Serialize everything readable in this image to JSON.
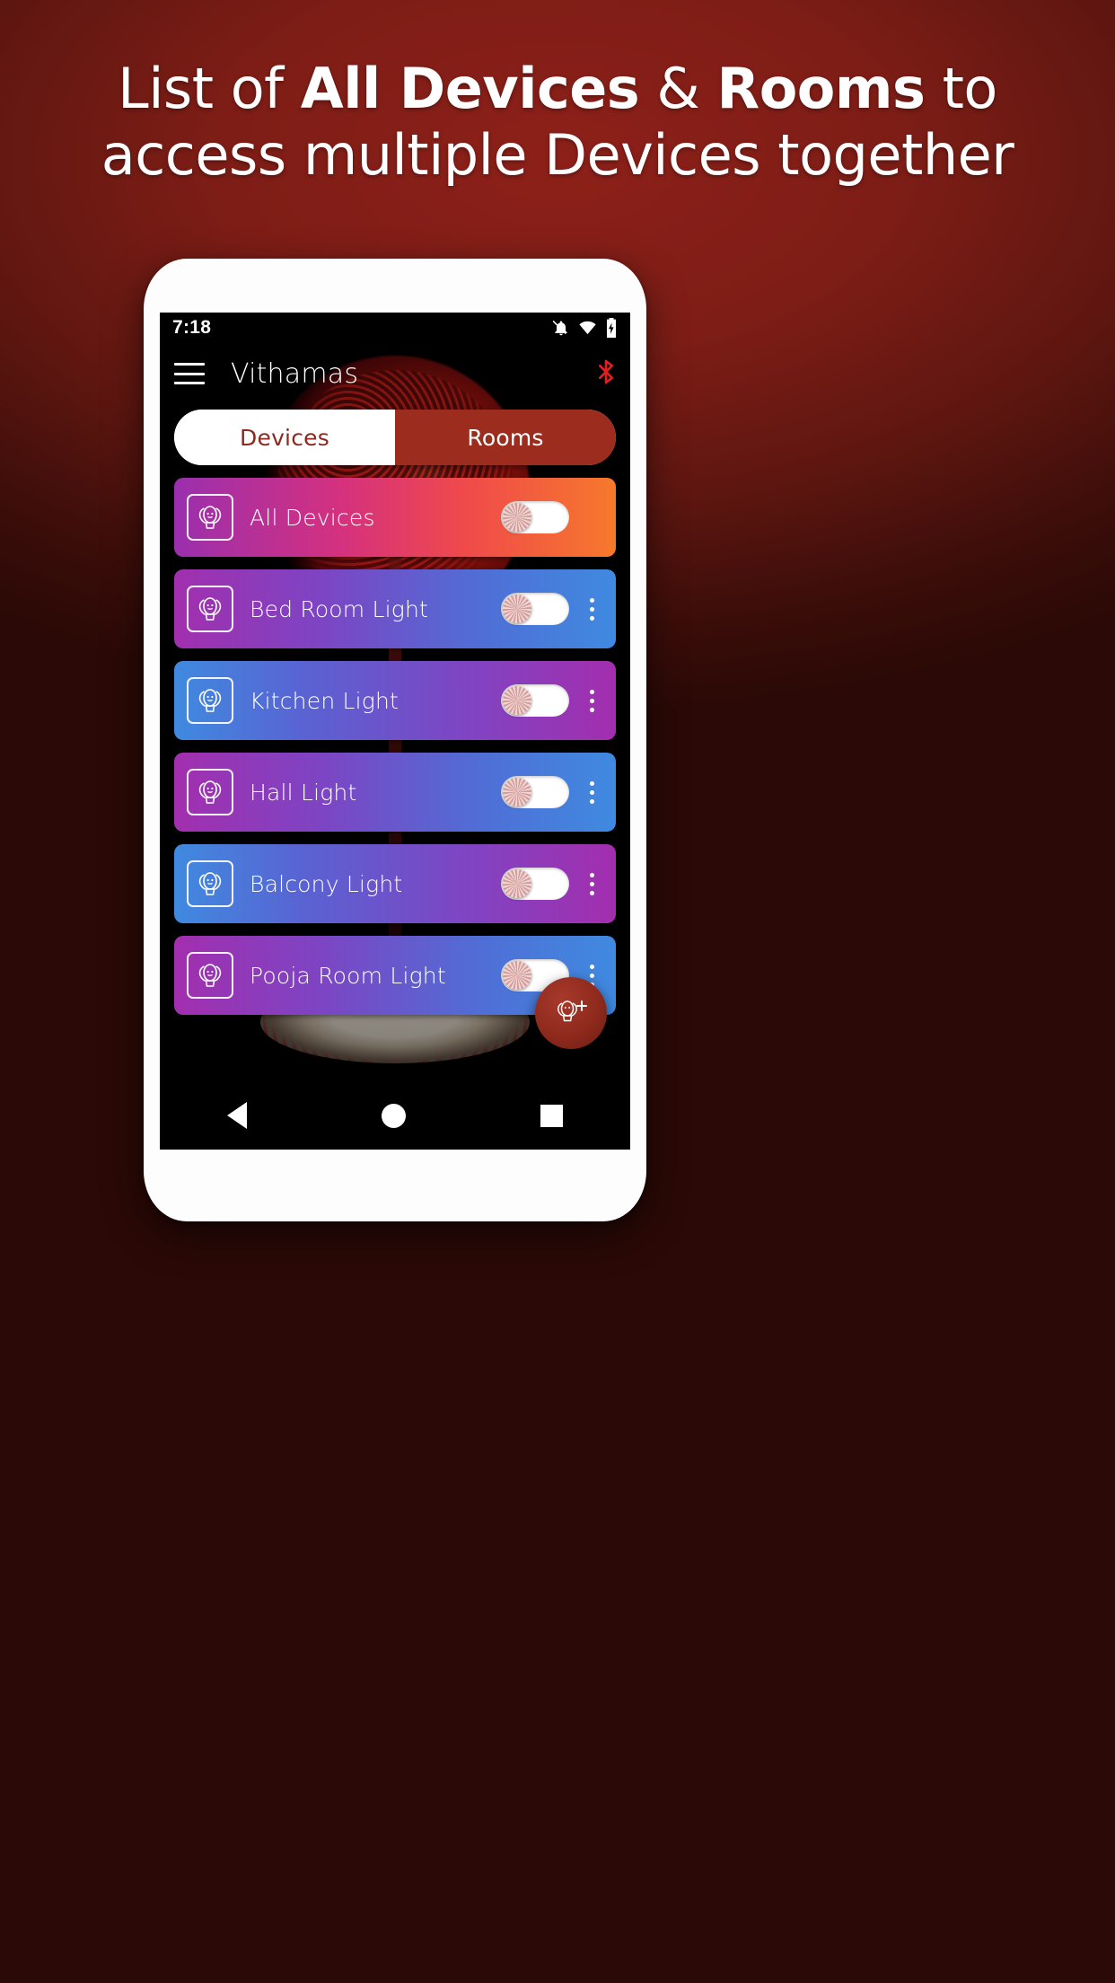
{
  "promo": {
    "line1_pre": "List of ",
    "line1_bold": "All Devices",
    "line1_mid": " & ",
    "line1_bold2": "Rooms",
    "line1_post": " to",
    "line2": "access multiple Devices together"
  },
  "colors": {
    "background_red": "#7d1d16",
    "tab_active_bg": "#9c2c1d",
    "tab_inactive_text": "#8a2a20",
    "bluetooth": "#e02020",
    "fab": "#8e2a1d"
  },
  "phone": {
    "statusbar": {
      "time": "7:18",
      "icons": [
        "notifications-off-icon",
        "wifi-icon",
        "battery-charging-icon"
      ]
    },
    "appbar": {
      "menu_icon": "hamburger-menu-icon",
      "title": "Vithamas",
      "action_icon": "bluetooth-icon"
    },
    "tabs": [
      {
        "label": "Devices",
        "active": false
      },
      {
        "label": "Rooms",
        "active": true
      }
    ],
    "devices": [
      {
        "label": "All Devices",
        "icon": "light-bulb-icon",
        "toggle_on": false,
        "has_overflow": false,
        "gradient": "g-all"
      },
      {
        "label": "Bed Room Light",
        "icon": "light-bulb-icon",
        "toggle_on": false,
        "has_overflow": true,
        "gradient": "g-a"
      },
      {
        "label": "Kitchen Light",
        "icon": "light-bulb-icon",
        "toggle_on": false,
        "has_overflow": true,
        "gradient": "g-b"
      },
      {
        "label": "Hall Light",
        "icon": "light-bulb-icon",
        "toggle_on": false,
        "has_overflow": true,
        "gradient": "g-a"
      },
      {
        "label": "Balcony Light",
        "icon": "light-bulb-icon",
        "toggle_on": false,
        "has_overflow": true,
        "gradient": "g-b"
      },
      {
        "label": "Pooja Room Light",
        "icon": "light-bulb-icon",
        "toggle_on": false,
        "has_overflow": true,
        "gradient": "g-a"
      }
    ],
    "fab": {
      "icon": "add-bulb-icon"
    },
    "navbar": {
      "back": "back-triangle-icon",
      "home": "home-circle-icon",
      "recent": "recents-square-icon"
    }
  }
}
